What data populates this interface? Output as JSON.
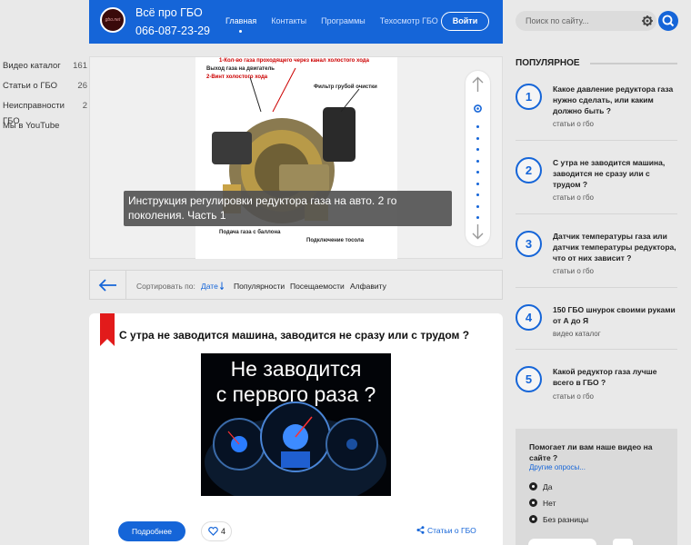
{
  "header": {
    "site_title": "Всё про ГБО",
    "phone": "066-087-23-29",
    "logo_text": "gbo.net",
    "nav": [
      {
        "label": "Главная",
        "active": true
      },
      {
        "label": "Контакты",
        "active": false
      },
      {
        "label": "Программы",
        "active": false
      },
      {
        "label": "Техосмотр ГБО",
        "active": false
      }
    ],
    "login_label": "Войти",
    "accent_color": "#1565d8"
  },
  "search": {
    "placeholder": "Поиск по сайту...",
    "gear_icon": "gear-icon",
    "button_icon": "search-icon"
  },
  "sidebar": {
    "items": [
      {
        "label": "Видео каталог",
        "count": "161"
      },
      {
        "label": "Статьи о ГБО",
        "count": "26"
      },
      {
        "label": "Неисправности ГБО",
        "count": "2"
      },
      {
        "label": "Мы в YouTube",
        "count": ""
      }
    ]
  },
  "slider": {
    "caption": "Инструкция регулировки редуктора газа на авто. 2 го поколения. Часть 1",
    "image_labels": {
      "l1": "1-Кол-во газа проходящего через канал холостого хода",
      "l2": "Выход газа на двигатель",
      "l3": "2-Винт холостого хода",
      "l4": "Фильтр грубой очистки",
      "l5": "Подача газа с баллона",
      "l6": "Подключение тосола"
    },
    "bullets_count": 10,
    "active_bullet": 0
  },
  "sortbar": {
    "label": "Сортировать по:",
    "options": [
      {
        "label": "Дате",
        "active": true
      },
      {
        "label": "Популярности",
        "active": false
      },
      {
        "label": "Посещаемости",
        "active": false
      },
      {
        "label": "Алфавиту",
        "active": false
      }
    ]
  },
  "article": {
    "title": "С утра не заводится машина, заводится не сразу или с трудом ?",
    "image_line1": "Не заводится",
    "image_line2": "с первого раза ?",
    "more_label": "Подробнее",
    "likes": "4",
    "category": "Статьи о ГБО"
  },
  "popular": {
    "heading": "ПОПУЛЯРНОЕ",
    "items": [
      {
        "num": "1",
        "title": "Какое давление редуктора газа нужно сделать, или каким должно быть ?",
        "category": "статьи о гбо"
      },
      {
        "num": "2",
        "title": "С утра не заводится машина, заводится не сразу или с трудом ?",
        "category": "статьи о гбо"
      },
      {
        "num": "3",
        "title": "Датчик температуры газа или датчик температуры редуктора, что от них зависит ?",
        "category": "статьи о гбо"
      },
      {
        "num": "4",
        "title": "150 ГБО шнурок своими руками от А до Я",
        "category": "видео каталог"
      },
      {
        "num": "5",
        "title": "Какой редуктор газа лучше всего в ГБО ?",
        "category": "статьи о гбо"
      }
    ]
  },
  "poll": {
    "question": "Помогает ли вам наше видео на сайте ?",
    "other_link": "Другие опросы...",
    "options": [
      "Да",
      "Нет",
      "Без разницы"
    ]
  }
}
